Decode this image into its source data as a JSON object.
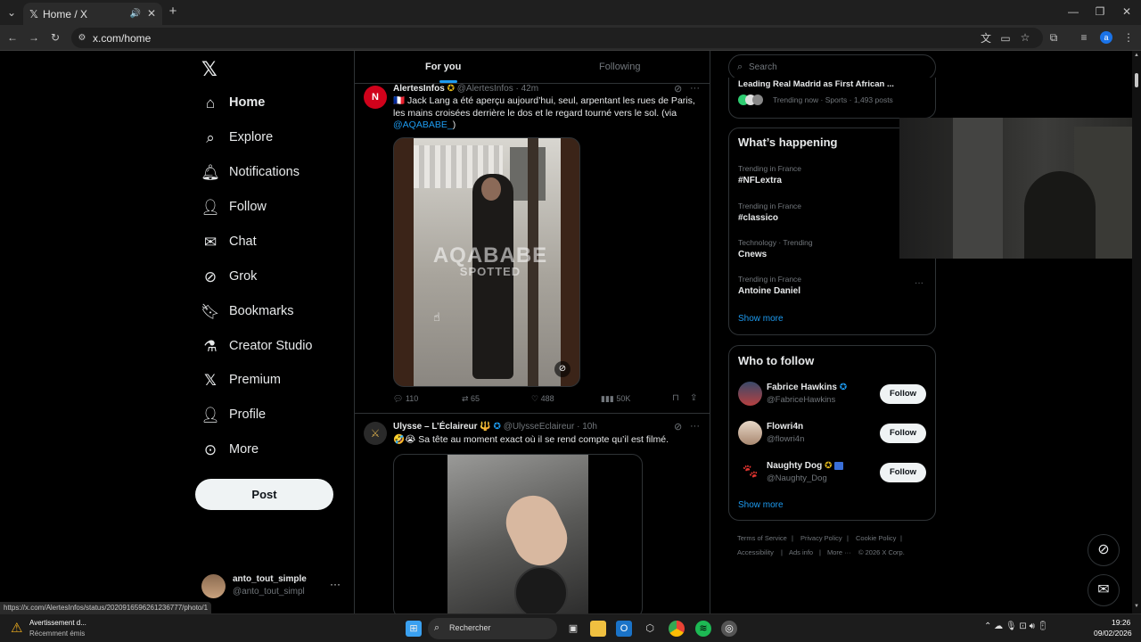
{
  "browser": {
    "tab_title": "Home / X",
    "url": "x.com/home",
    "status_url": "https://x.com/AlertesInfos/status/2020916596261236777/photo/1",
    "profile_letter": "a"
  },
  "nav": {
    "items": [
      {
        "label": "Home",
        "icon": "home-icon"
      },
      {
        "label": "Explore",
        "icon": "search-icon"
      },
      {
        "label": "Notifications",
        "icon": "bell-icon"
      },
      {
        "label": "Follow",
        "icon": "person-plus-icon"
      },
      {
        "label": "Chat",
        "icon": "mail-icon"
      },
      {
        "label": "Grok",
        "icon": "grok-icon"
      },
      {
        "label": "Bookmarks",
        "icon": "bookmark-icon"
      },
      {
        "label": "Creator Studio",
        "icon": "flask-icon"
      },
      {
        "label": "Premium",
        "icon": "x-logo-icon"
      },
      {
        "label": "Profile",
        "icon": "person-icon"
      },
      {
        "label": "More",
        "icon": "more-circle-icon"
      }
    ],
    "post_label": "Post",
    "account": {
      "name": "anto_tout_simple",
      "handle": "@anto_tout_simpl",
      "more": "···"
    }
  },
  "feed": {
    "tabs": [
      "For you",
      "Following"
    ],
    "tweet1": {
      "name": "AlertesInfos",
      "handle": "@AlertesInfos",
      "time": "· 42m",
      "text1": "🇫🇷 Jack Lang a été aperçu aujourd’hui, seul, arpentant les rues de Paris, les mains croisées derrière le dos et le regard tourné vers le sol. (via",
      "mention": "@AQABABE_",
      "text2": ")",
      "watermark1": "AQABABE",
      "watermark2": "SPOTTED",
      "replies": "110",
      "reposts": "65",
      "likes": "488",
      "views": "50K"
    },
    "tweet2": {
      "name": "Ulysse – L’Éclaireur 🔱",
      "handle": "@UlysseEclaireur",
      "time": "· 10h",
      "text": "🤣😭 Sa tête au moment exact où il se rend compte qu’il est filmé."
    }
  },
  "right": {
    "search_placeholder": "Search",
    "top_trend": {
      "title": "Leading Real Madrid as First African ...",
      "meta": "Trending now · Sports · 1,493 posts"
    },
    "happening_title": "What’s happening",
    "trends": [
      {
        "cat": "Trending in France",
        "name": "#NFLextra"
      },
      {
        "cat": "Trending in France",
        "name": "#classico"
      },
      {
        "cat": "Technology · Trending",
        "name": "Cnews"
      },
      {
        "cat": "Trending in France",
        "name": "Antoine Daniel"
      }
    ],
    "show_more": "Show more",
    "who_title": "Who to follow",
    "follow": [
      {
        "name": "Fabrice Hawkins",
        "handle": "@FabriceHawkins"
      },
      {
        "name": "Flowri4n",
        "handle": "@flowri4n"
      },
      {
        "name": "Naughty Dog",
        "handle": "@Naughty_Dog"
      }
    ],
    "follow_label": "Follow",
    "show_more2": "Show more",
    "footer": {
      "line1": [
        "Terms of Service",
        "|",
        "Privacy Policy",
        "|",
        "Cookie Policy",
        "|"
      ],
      "line2": [
        "Accessibility",
        "|",
        "Ads info",
        "|",
        "More ···",
        "© 2026 X Corp."
      ]
    }
  },
  "taskbar": {
    "notification_title": "Avertissement d...",
    "notification_sub": "Récemment émis",
    "search_placeholder": "Rechercher",
    "time": "19:26",
    "date": "09/02/2026"
  },
  "colors": {
    "accent": "#1d9bf0",
    "verified_gold": "#e2b719",
    "bg": "#000000"
  }
}
